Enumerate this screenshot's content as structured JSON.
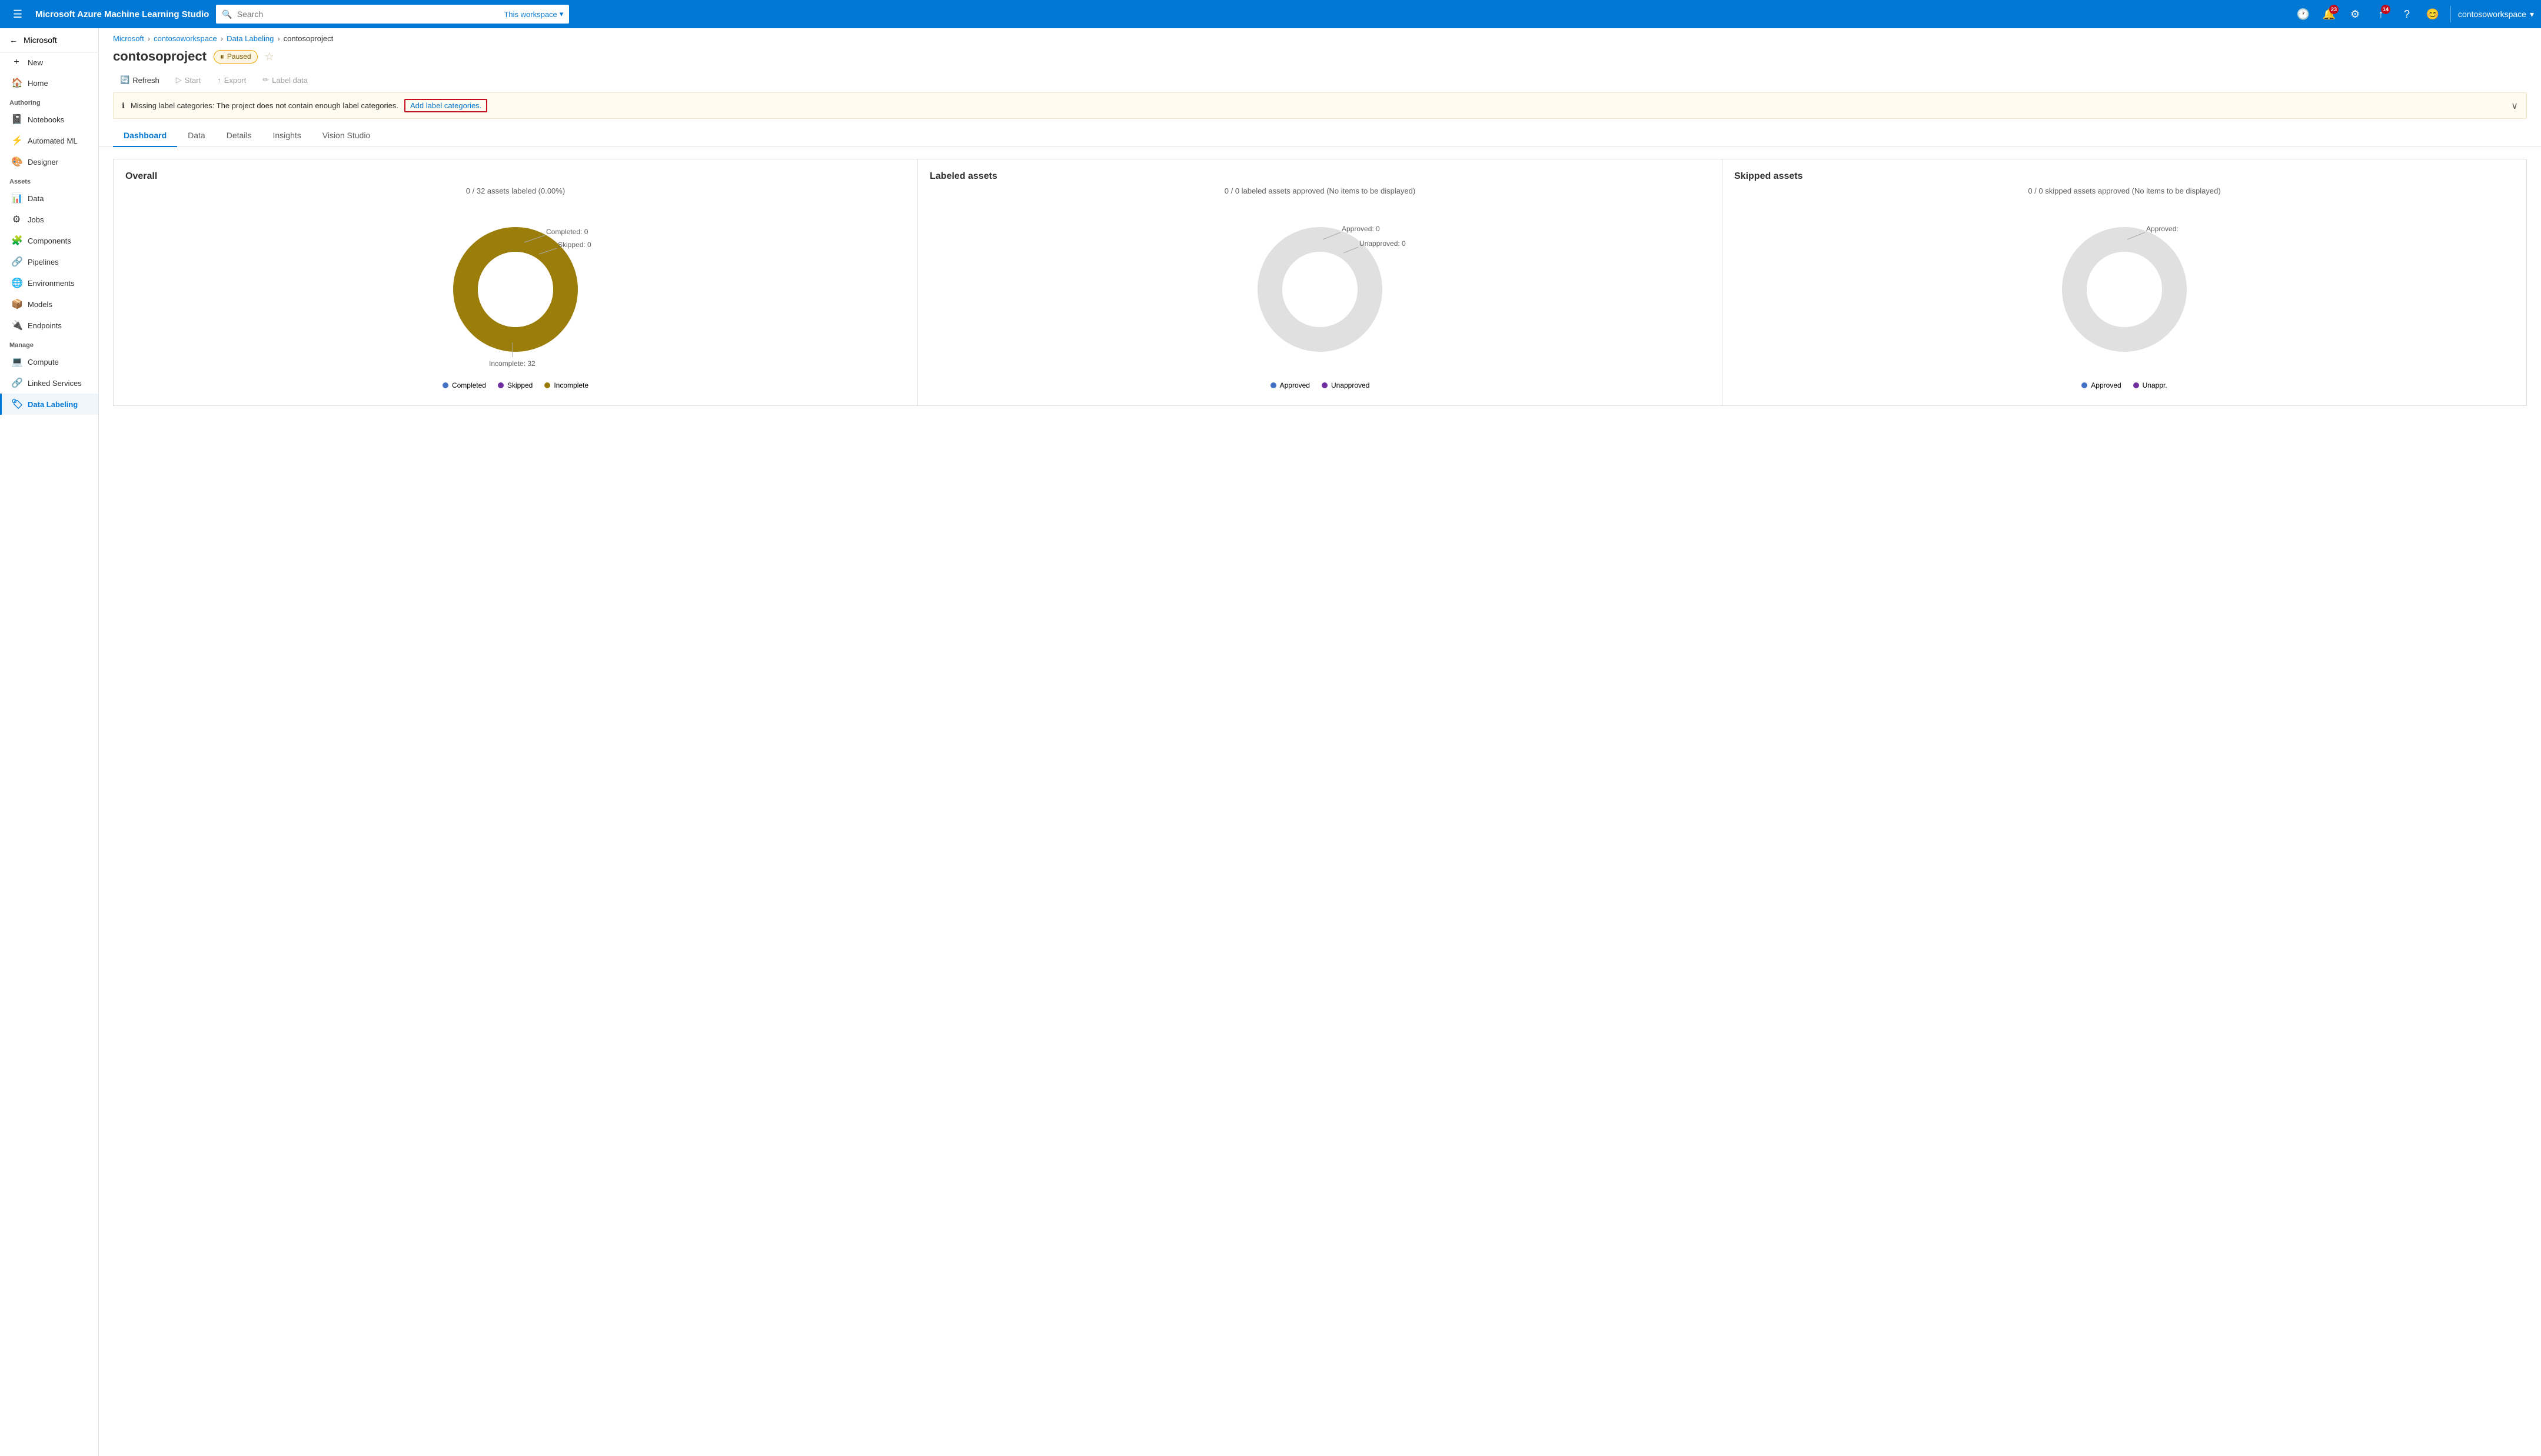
{
  "app": {
    "brand": "Microsoft Azure Machine Learning Studio"
  },
  "topnav": {
    "search_placeholder": "Search",
    "search_workspace": "This workspace",
    "notifications_count": "23",
    "updates_count": "14",
    "workspace_name": "contosoworkspace"
  },
  "breadcrumb": {
    "items": [
      "Microsoft",
      "contosoworkspace",
      "Data Labeling"
    ],
    "current": "contosoproject"
  },
  "page": {
    "title": "contosoproject",
    "status": "Paused"
  },
  "toolbar": {
    "refresh": "Refresh",
    "start": "Start",
    "export": "Export",
    "label_data": "Label data"
  },
  "alert": {
    "message": "Missing label categories: The project does not contain enough label categories.",
    "link_text": "Add label categories."
  },
  "tabs": {
    "items": [
      "Dashboard",
      "Data",
      "Details",
      "Insights",
      "Vision Studio"
    ],
    "active": "Dashboard"
  },
  "sidebar": {
    "top_item": "Microsoft",
    "new_label": "New",
    "home_label": "Home",
    "section_authoring": "Authoring",
    "section_assets": "Assets",
    "section_manage": "Manage",
    "items_authoring": [
      {
        "id": "notebooks",
        "label": "Notebooks",
        "icon": "📓"
      },
      {
        "id": "automated-ml",
        "label": "Automated ML",
        "icon": "🤖"
      },
      {
        "id": "designer",
        "label": "Designer",
        "icon": "🎨"
      }
    ],
    "items_assets": [
      {
        "id": "data",
        "label": "Data",
        "icon": "📊"
      },
      {
        "id": "jobs",
        "label": "Jobs",
        "icon": "⚙"
      },
      {
        "id": "components",
        "label": "Components",
        "icon": "🧩"
      },
      {
        "id": "pipelines",
        "label": "Pipelines",
        "icon": "🔗"
      },
      {
        "id": "environments",
        "label": "Environments",
        "icon": "🌐"
      },
      {
        "id": "models",
        "label": "Models",
        "icon": "📦"
      },
      {
        "id": "endpoints",
        "label": "Endpoints",
        "icon": "🔌"
      }
    ],
    "items_manage": [
      {
        "id": "compute",
        "label": "Compute",
        "icon": "💻"
      },
      {
        "id": "linked-services",
        "label": "Linked Services",
        "icon": "🔗"
      },
      {
        "id": "data-labeling",
        "label": "Data Labeling",
        "icon": "🏷",
        "active": true
      }
    ]
  },
  "overall_chart": {
    "title": "Overall",
    "subtitle": "0 / 32 assets labeled (0.00%)",
    "completed_label": "Completed: 0",
    "skipped_label": "Skipped: 0",
    "incomplete_label": "Incomplete: 32",
    "legend": [
      {
        "label": "Completed",
        "color": "#4472c4"
      },
      {
        "label": "Skipped",
        "color": "#7030a0"
      },
      {
        "label": "Incomplete",
        "color": "#9a7d0a"
      }
    ],
    "donut_color": "#9a7d0a",
    "donut_empty_color": "#e0d8b0"
  },
  "labeled_assets_chart": {
    "title": "Labeled assets",
    "subtitle": "0 / 0 labeled assets approved (No items to be displayed)",
    "approved_label": "Approved: 0",
    "unapproved_label": "Unapproved: 0",
    "legend": [
      {
        "label": "Approved",
        "color": "#4472c4"
      },
      {
        "label": "Unapproved",
        "color": "#7030a0"
      }
    ],
    "donut_color": "#d9d9d9"
  },
  "skipped_assets_chart": {
    "title": "Skipped assets",
    "subtitle": "0 / 0 skipped assets approved (No items to be displayed)",
    "approved_label": "Approved:",
    "legend": [
      {
        "label": "Approved",
        "color": "#4472c4"
      },
      {
        "label": "Unappr.",
        "color": "#7030a0"
      }
    ],
    "donut_color": "#d9d9d9"
  }
}
